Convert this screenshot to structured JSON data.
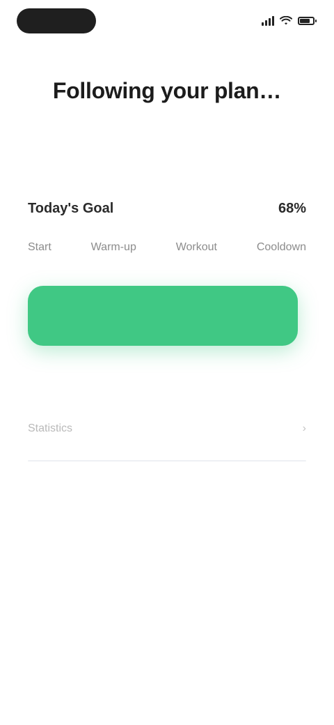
{
  "status_bar": {
    "time": "",
    "icons": [
      "signal-icon",
      "wifi-icon",
      "battery-icon"
    ],
    "battery_level": 0.8
  },
  "header": {
    "title": "Following your plan…",
    "subtitle": ""
  },
  "progress": {
    "label": "Today's Goal",
    "value": "68%",
    "steps": [
      "Start",
      "Warm-up",
      "Workout",
      "Cooldown"
    ]
  },
  "primary_button": {
    "label": ""
  },
  "info": {
    "label": "Statistics",
    "value": "›"
  },
  "colors": {
    "accent": "#40c884",
    "text_dark": "#222222",
    "text_muted": "#b9b9b9",
    "divider": "#eef0f4"
  }
}
